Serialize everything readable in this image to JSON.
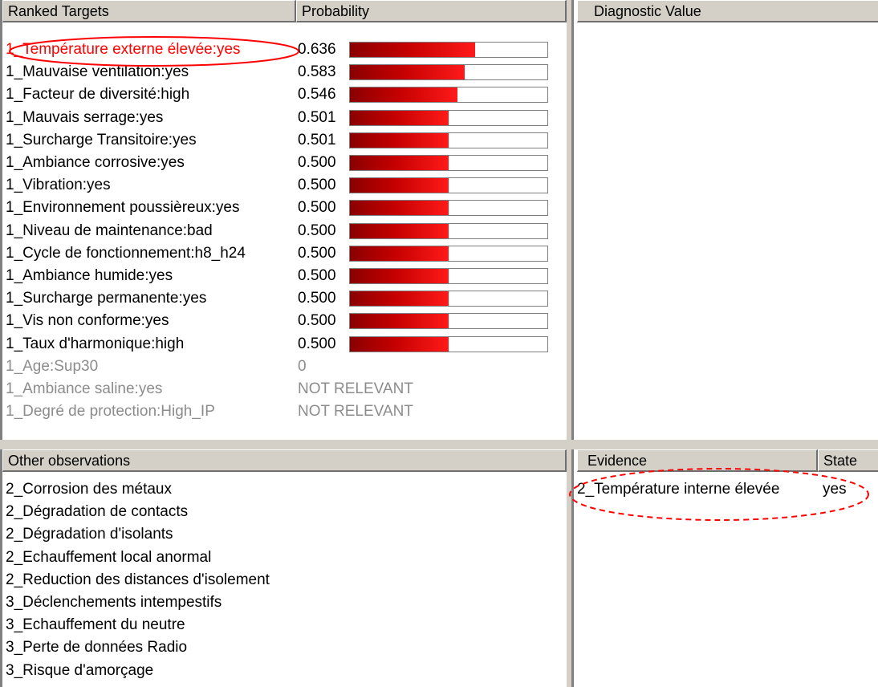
{
  "ranked_targets": {
    "header_target": "Ranked Targets",
    "header_probability": "Probability",
    "rows": [
      {
        "label": "1_Température externe élevée:yes",
        "value": "0.636",
        "prob": 0.636,
        "highlighted": true
      },
      {
        "label": "1_Mauvaise ventilation:yes",
        "value": "0.583",
        "prob": 0.583
      },
      {
        "label": "1_Facteur de diversité:high",
        "value": "0.546",
        "prob": 0.546
      },
      {
        "label": "1_Mauvais serrage:yes",
        "value": "0.501",
        "prob": 0.501
      },
      {
        "label": "1_Surcharge Transitoire:yes",
        "value": "0.501",
        "prob": 0.501
      },
      {
        "label": "1_Ambiance corrosive:yes",
        "value": "0.500",
        "prob": 0.5
      },
      {
        "label": "1_Vibration:yes",
        "value": "0.500",
        "prob": 0.5
      },
      {
        "label": "1_Environnement poussièreux:yes",
        "value": "0.500",
        "prob": 0.5
      },
      {
        "label": "1_Niveau de maintenance:bad",
        "value": "0.500",
        "prob": 0.5
      },
      {
        "label": "1_Cycle de fonctionnement:h8_h24",
        "value": "0.500",
        "prob": 0.5
      },
      {
        "label": "1_Ambiance humide:yes",
        "value": "0.500",
        "prob": 0.5
      },
      {
        "label": "1_Surcharge permanente:yes",
        "value": "0.500",
        "prob": 0.5
      },
      {
        "label": "1_Vis non conforme:yes",
        "value": "0.500",
        "prob": 0.5
      },
      {
        "label": "1_Taux d'harmonique:high",
        "value": "0.500",
        "prob": 0.5
      },
      {
        "label": "1_Age:Sup30",
        "value": "0",
        "prob": null,
        "dim": true
      },
      {
        "label": "1_Ambiance saline:yes",
        "value": "NOT RELEVANT",
        "prob": null,
        "dim": true
      },
      {
        "label": "1_Degré de protection:High_IP",
        "value": "NOT RELEVANT",
        "prob": null,
        "dim": true
      }
    ]
  },
  "diagnostic": {
    "header": "Diagnostic Value"
  },
  "other_observations": {
    "header": "Other observations",
    "items": [
      "2_Corrosion des métaux",
      "2_Dégradation de contacts",
      "2_Dégradation d'isolants",
      "2_Echauffement local anormal",
      "2_Reduction des distances d'isolement",
      "3_Déclenchements intempestifs",
      "3_Echauffement du neutre",
      "3_Perte de données Radio",
      "3_Risque d'amorçage"
    ]
  },
  "evidence": {
    "header_evidence": "Evidence",
    "header_state": "State",
    "rows": [
      {
        "name": "2_Température interne élevée",
        "state": "yes"
      }
    ]
  },
  "colors": {
    "highlight_text": "#ff0000",
    "bar_dark": "#8a0000",
    "bar_light": "#ff1a1a",
    "annotation": "#ff0000",
    "dim_text": "#8c8c8c",
    "chrome": "#d4d0c8"
  }
}
